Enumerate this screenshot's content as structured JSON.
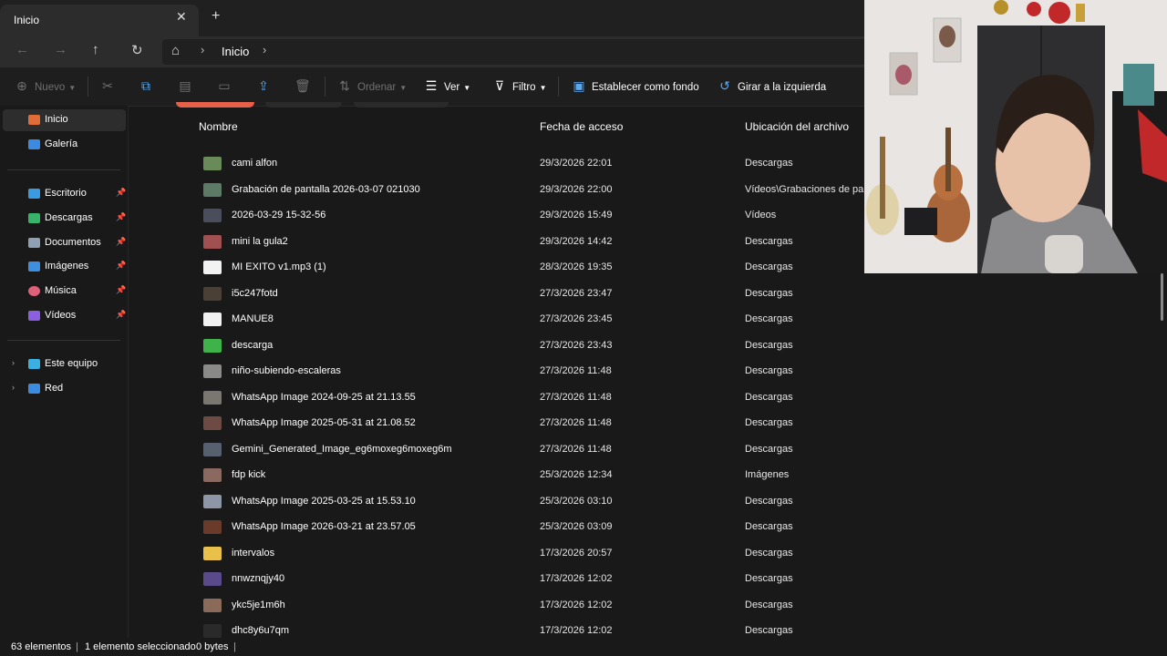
{
  "tab": {
    "title": "Inicio",
    "close_icon": "close-icon",
    "new_tab_icon": "plus-icon"
  },
  "nav": {
    "back_icon": "arrow-left-icon",
    "forward_icon": "arrow-right-icon",
    "up_icon": "arrow-up-icon",
    "refresh_icon": "refresh-icon"
  },
  "address": {
    "home_icon": "home-icon",
    "crumb": "Inicio"
  },
  "toolbar": {
    "new_label": "Nuevo",
    "sort_label": "Ordenar",
    "view_label": "Ver",
    "filter_label": "Filtro",
    "set_background_label": "Establecer como fondo",
    "rotate_left_label": "Girar a la izquierda",
    "cut_icon": "scissors-icon",
    "copy_icon": "copy-icon",
    "paste_icon": "paste-icon",
    "rename_icon": "rename-icon",
    "share_icon": "share-icon",
    "delete_icon": "trash-icon"
  },
  "sidebar": {
    "items": [
      {
        "label": "Inicio",
        "icon": "home-icon",
        "color": "#e06c3a",
        "pinned": false,
        "active": true
      },
      {
        "label": "Galería",
        "icon": "gallery-icon",
        "color": "#3d8be0",
        "pinned": false,
        "active": false
      },
      {
        "label": "Escritorio",
        "icon": "desktop-icon",
        "color": "#3b9be0",
        "pinned": true,
        "active": false
      },
      {
        "label": "Descargas",
        "icon": "download-icon",
        "color": "#3ab36a",
        "pinned": true,
        "active": false
      },
      {
        "label": "Documentos",
        "icon": "document-icon",
        "color": "#8fa0b5",
        "pinned": true,
        "active": false
      },
      {
        "label": "Imágenes",
        "icon": "pictures-icon",
        "color": "#3f8fe0",
        "pinned": true,
        "active": false
      },
      {
        "label": "Música",
        "icon": "music-icon",
        "color": "#e0607a",
        "pinned": true,
        "active": false
      },
      {
        "label": "Vídeos",
        "icon": "video-icon",
        "color": "#8b5fe0",
        "pinned": true,
        "active": false
      },
      {
        "label": "Este equipo",
        "icon": "computer-icon",
        "color": "#3ab0e0",
        "pinned": false,
        "active": false
      },
      {
        "label": "Red",
        "icon": "network-icon",
        "color": "#3b8be0",
        "pinned": false,
        "active": false
      }
    ]
  },
  "columns": {
    "name": "Nombre",
    "date": "Fecha de acceso",
    "location": "Ubicación del archivo"
  },
  "files": [
    {
      "name": "cami alfon",
      "date": "29/3/2026 22:01",
      "location": "Descargas",
      "thumb": "#6b8a5a"
    },
    {
      "name": "Grabación de pantalla 2026-03-07 021030",
      "date": "29/3/2026 22:00",
      "location": "Vídeos\\Grabaciones de pantalla",
      "thumb": "#5c7a66"
    },
    {
      "name": "2026-03-29 15-32-56",
      "date": "29/3/2026 15:49",
      "location": "Vídeos",
      "thumb": "#4a4e5c"
    },
    {
      "name": "mini la gula2",
      "date": "29/3/2026 14:42",
      "location": "Descargas",
      "thumb": "#a05050"
    },
    {
      "name": "MI EXITO v1.mp3 (1)",
      "date": "28/3/2026 19:35",
      "location": "Descargas",
      "thumb": "#f2f2f2"
    },
    {
      "name": "i5c247fotd",
      "date": "27/3/2026 23:47",
      "location": "Descargas",
      "thumb": "#4a4036"
    },
    {
      "name": "MANUE8",
      "date": "27/3/2026 23:45",
      "location": "Descargas",
      "thumb": "#f2f2f2"
    },
    {
      "name": "descarga",
      "date": "27/3/2026 23:43",
      "location": "Descargas",
      "thumb": "#3fb34a"
    },
    {
      "name": "niño-subiendo-escaleras",
      "date": "27/3/2026 11:48",
      "location": "Descargas",
      "thumb": "#8a8a88"
    },
    {
      "name": "WhatsApp Image 2024-09-25 at 21.13.55",
      "date": "27/3/2026 11:48",
      "location": "Descargas",
      "thumb": "#7a7670"
    },
    {
      "name": "WhatsApp Image 2025-05-31 at 21.08.52",
      "date": "27/3/2026 11:48",
      "location": "Descargas",
      "thumb": "#6e4a44"
    },
    {
      "name": "Gemini_Generated_Image_eg6moxeg6moxeg6m",
      "date": "27/3/2026 11:48",
      "location": "Descargas",
      "thumb": "#56606e"
    },
    {
      "name": "fdp kick",
      "date": "25/3/2026 12:34",
      "location": "Imágenes",
      "thumb": "#8a6a60"
    },
    {
      "name": "WhatsApp Image 2025-03-25 at 15.53.10",
      "date": "25/3/2026 03:10",
      "location": "Descargas",
      "thumb": "#8c96a6"
    },
    {
      "name": "WhatsApp Image 2026-03-21 at 23.57.05",
      "date": "25/3/2026 03:09",
      "location": "Descargas",
      "thumb": "#6a3a2a"
    },
    {
      "name": "intervalos",
      "date": "17/3/2026 20:57",
      "location": "Descargas",
      "thumb": "#e8c04a"
    },
    {
      "name": "nnwznqjy40",
      "date": "17/3/2026 12:02",
      "location": "Descargas",
      "thumb": "#5a4a8a"
    },
    {
      "name": "ykc5je1m6h",
      "date": "17/3/2026 12:02",
      "location": "Descargas",
      "thumb": "#8a6a58"
    },
    {
      "name": "dhc8y6u7qm",
      "date": "17/3/2026 12:02",
      "location": "Descargas",
      "thumb": "#2a2a2a"
    }
  ],
  "status": {
    "count": "63 elementos",
    "selected": "1 elemento seleccionado",
    "size": "0 bytes"
  },
  "colors": {
    "background": "#191919",
    "accent": "#e8604a"
  }
}
